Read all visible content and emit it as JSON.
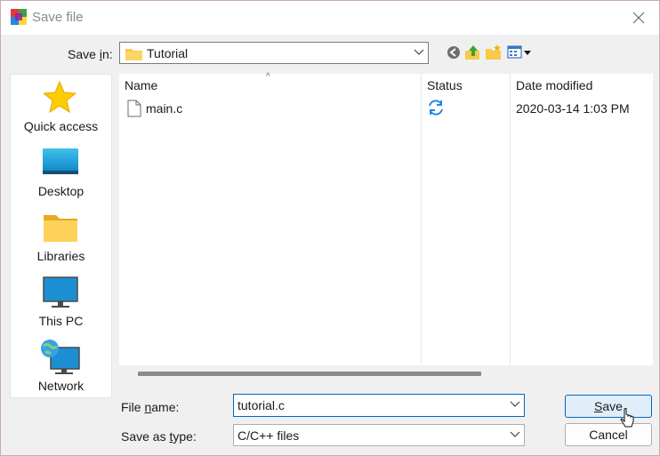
{
  "window": {
    "title": "Save file"
  },
  "toolbar": {
    "save_in_label": "Save in:",
    "save_in_label_pre": "Save ",
    "save_in_label_key": "i",
    "save_in_label_post": "n:",
    "current_folder": "Tutorial",
    "buttons": [
      "back-icon",
      "up-folder-icon",
      "new-folder-icon",
      "view-menu-icon"
    ]
  },
  "places": [
    {
      "label": "Quick access",
      "icon": "star-icon"
    },
    {
      "label": "Desktop",
      "icon": "desktop-icon"
    },
    {
      "label": "Libraries",
      "icon": "libraries-icon"
    },
    {
      "label": "This PC",
      "icon": "computer-icon"
    },
    {
      "label": "Network",
      "icon": "network-icon"
    }
  ],
  "file_list": {
    "columns": [
      "Name",
      "Status",
      "Date modified"
    ],
    "rows": [
      {
        "name": "main.c",
        "status": "sync-icon",
        "date_modified": "2020-03-14 1:03 PM"
      }
    ]
  },
  "form": {
    "file_name_label": "File name:",
    "file_name_label_pre": "File ",
    "file_name_label_key": "n",
    "file_name_label_post": "ame:",
    "file_name_value": "tutorial.c",
    "save_as_type_label": "Save as type:",
    "save_as_type_label_pre": "Save as ",
    "save_as_type_label_key": "t",
    "save_as_type_label_post": "ype:",
    "save_as_type_value": "C/C++ files"
  },
  "buttons": {
    "save": "Save",
    "save_key": "S",
    "save_rest": "ave",
    "cancel": "Cancel"
  },
  "colors": {
    "accent": "#0067c0",
    "folder": "#f8c94a",
    "star": "#ffcc00"
  }
}
